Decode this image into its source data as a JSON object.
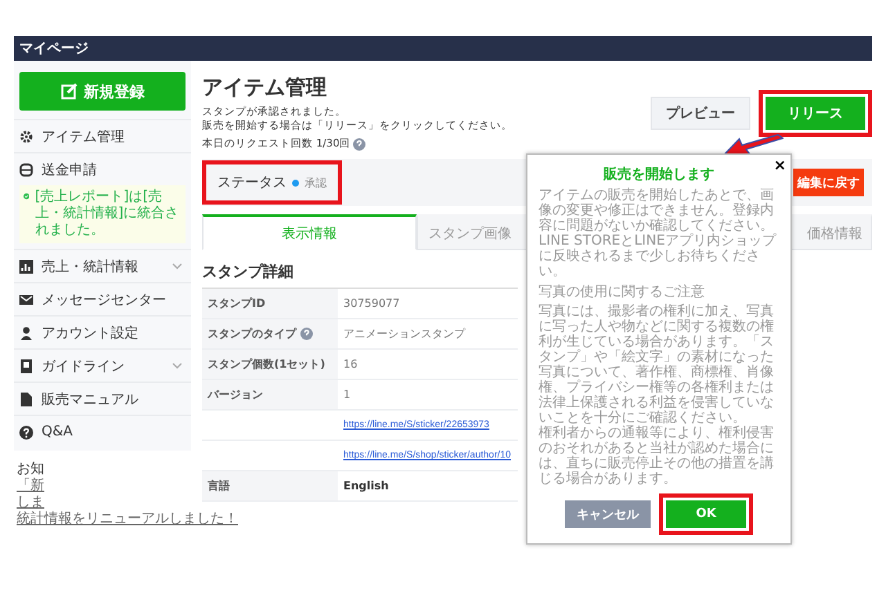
{
  "header": {
    "title": "マイページ"
  },
  "sidebar": {
    "new_button": "新規登録",
    "items_top": [
      {
        "label": "アイテム管理",
        "expandable": false
      },
      {
        "label": "送金申請",
        "expandable": false
      }
    ],
    "notice": "[売上レポート]は[売上・統計情報]に統合されました。",
    "items": [
      {
        "label": "売上・統計情報",
        "expandable": true
      },
      {
        "label": "メッセージセンター",
        "expandable": false
      },
      {
        "label": "アカウント設定",
        "expandable": false
      },
      {
        "label": "ガイドライン",
        "expandable": true
      },
      {
        "label": "販売マニュアル",
        "expandable": false
      },
      {
        "label": "Q&A",
        "expandable": false
      }
    ],
    "news": {
      "heading": "お知",
      "links": [
        "「新",
        "しま",
        "統計情報をリニューアルしました！"
      ]
    }
  },
  "main": {
    "title": "アイテム管理",
    "messages": [
      "スタンプが承認されました。",
      "販売を開始する場合は「リリース」をクリックしてください。"
    ],
    "request_count": "本日のリクエスト回数 1/30回",
    "preview_button": "プレビュー",
    "release_button": "リリース",
    "status": {
      "label": "ステータス",
      "value": "承認"
    },
    "edit_button": "編集に戻す",
    "tabs": [
      {
        "label": "表示情報",
        "selected": true
      },
      {
        "label": "スタンプ画像",
        "selected": false
      },
      {
        "label": "価格情報",
        "selected": false
      }
    ],
    "section_title": "スタンプ詳細",
    "rows": [
      {
        "label": "スタンプID",
        "value": "30759077",
        "kind": "text",
        "help": false
      },
      {
        "label": "スタンプのタイプ",
        "value": "アニメーションスタンプ",
        "kind": "text",
        "help": true
      },
      {
        "label": "スタンプ個数(1セット)",
        "value": "16",
        "kind": "text",
        "help": false
      },
      {
        "label": "バージョン",
        "value": "1",
        "kind": "text",
        "help": false
      },
      {
        "value": "https://line.me/S/sticker/22653973",
        "kind": "link",
        "help": false
      },
      {
        "value": "https://line.me/S/shop/sticker/author/10",
        "kind": "link",
        "help": false
      },
      {
        "label": "言語",
        "value": "English",
        "kind": "bold",
        "help": false
      }
    ]
  },
  "modal": {
    "title": "販売を開始します",
    "close": "×",
    "paragraphs": [
      {
        "text": "アイテムの販売を開始したあとで、画像の変更や修正はできません。登録内容に問題がないか確認してください。",
        "kind": "body"
      },
      {
        "text": "LINE STOREとLINEアプリ内ショップに反映されるまで少しお待ちください。",
        "kind": "body"
      },
      {
        "text": "写真の使用に関するご注意",
        "kind": "heading"
      },
      {
        "text": "写真には、撮影者の権利に加え、写真に写った人や物などに関する複数の権利が生じている場合があります。「スタンプ」や「絵文字」の素材になった写真について、著作権、商標権、肖像権、プライバシー権等の各権利または法律上保護される利益を侵害していないことを十分にご確認ください。",
        "kind": "body"
      },
      {
        "text": "権利者からの通報等により、権利侵害のおそれがあると当社が認めた場合には、直ちに販売停止その他の措置を講じる場合があります。",
        "kind": "body"
      }
    ],
    "cancel_button": "キャンセル",
    "ok_button": "OK"
  }
}
